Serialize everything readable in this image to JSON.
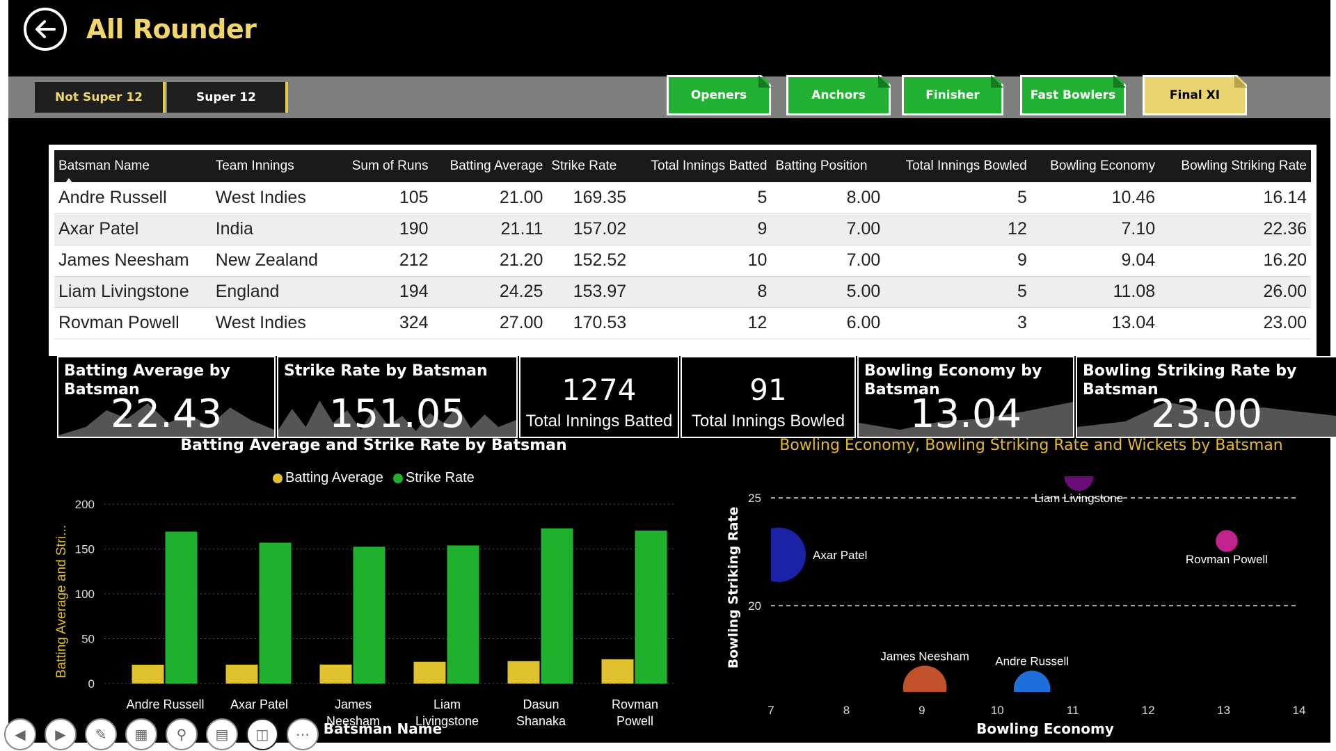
{
  "header": {
    "title": "All Rounder",
    "back_icon": "back-arrow-icon"
  },
  "slicers": [
    {
      "label": "Not Super 12",
      "selected": true
    },
    {
      "label": "Super 12",
      "selected": false
    }
  ],
  "nav_buttons": {
    "openers": "Openers",
    "anchors": "Anchors",
    "finisher": "Finisher",
    "fast_bowlers": "Fast Bowlers",
    "final_xi": "Final XI"
  },
  "colors": {
    "accent_yellow": "#e9d470",
    "green": "#22b133",
    "bar_yellow": "#e0c12e",
    "bar_green": "#1fb12d"
  },
  "table": {
    "columns": [
      "Batsman Name",
      "Team Innings",
      "Sum of Runs",
      "Batting Average",
      "Strike Rate",
      "Total Innings Batted",
      "Batting Position",
      "Total Innings Bowled",
      "Bowling Economy",
      "Bowling Striking Rate"
    ],
    "rows": [
      [
        "Andre Russell",
        "West Indies",
        "105",
        "21.00",
        "169.35",
        "5",
        "8.00",
        "5",
        "10.46",
        "16.14"
      ],
      [
        "Axar Patel",
        "India",
        "190",
        "21.11",
        "157.02",
        "9",
        "7.00",
        "12",
        "7.10",
        "22.36"
      ],
      [
        "James Neesham",
        "New Zealand",
        "212",
        "21.20",
        "152.52",
        "10",
        "7.00",
        "9",
        "9.04",
        "16.20"
      ],
      [
        "Liam Livingstone",
        "England",
        "194",
        "24.25",
        "153.97",
        "8",
        "5.00",
        "5",
        "11.08",
        "26.00"
      ],
      [
        "Rovman Powell",
        "West Indies",
        "324",
        "27.00",
        "170.53",
        "12",
        "6.00",
        "3",
        "13.04",
        "23.00"
      ]
    ]
  },
  "kpis": {
    "batting_avg": {
      "title": "Batting Average by Batsman",
      "value": "22.43"
    },
    "strike_rate": {
      "title": "Strike Rate by Batsman",
      "value": "151.05"
    },
    "innings_batted": {
      "value": "1274",
      "label": "Total Innings Batted"
    },
    "innings_bowled": {
      "value": "91",
      "label": "Total Innings Bowled"
    },
    "bowling_economy": {
      "title": "Bowling Economy by Batsman",
      "value": "13.04"
    },
    "bowling_sr": {
      "title": "Bowling Striking Rate by Batsman",
      "value": "23.00"
    }
  },
  "chart_data": [
    {
      "type": "bar",
      "title": "Batting Average and Strike Rate by Batsman",
      "xlabel": "Batsman Name",
      "ylabel": "Batting Average and Stri...",
      "ylim": [
        0,
        200
      ],
      "yticks": [
        0,
        50,
        100,
        150,
        200
      ],
      "categories": [
        "Andre Russell",
        "Axar Patel",
        "James Neesham",
        "Liam Livingstone",
        "Dasun Shanaka",
        "Rovman Powell"
      ],
      "category_lines": [
        [
          "Andre Russell"
        ],
        [
          "Axar Patel"
        ],
        [
          "James",
          "Neesham"
        ],
        [
          "Liam",
          "Livingstone"
        ],
        [
          "Dasun",
          "Shanaka"
        ],
        [
          "Rovman",
          "Powell"
        ]
      ],
      "series": [
        {
          "name": "Batting Average",
          "color": "#e0c12e",
          "values": [
            21.0,
            21.11,
            21.2,
            24.25,
            25.0,
            27.0
          ]
        },
        {
          "name": "Strike Rate",
          "color": "#1fb12d",
          "values": [
            169.35,
            157.02,
            152.52,
            153.97,
            173.0,
            170.53
          ]
        }
      ],
      "legend": "top-center",
      "grid": true
    },
    {
      "type": "scatter",
      "title": "Bowling Economy, Bowling Striking Rate and Wickets by Batsman",
      "xlabel": "Bowling Economy",
      "ylabel": "Bowling Striking Rate",
      "xticks": [
        7,
        8,
        9,
        10,
        11,
        12,
        13,
        14
      ],
      "yticks": [
        20,
        25
      ],
      "xlim": [
        7,
        14
      ],
      "ylim": [
        16,
        26
      ],
      "grid": true,
      "points": [
        {
          "label": "Axar Patel",
          "x": 7.1,
          "y": 22.36,
          "size": 12,
          "color": "#1a22a8"
        },
        {
          "label": "Liam Livingstone",
          "x": 11.08,
          "y": 26.0,
          "size": 5,
          "color": "#6a0d7a"
        },
        {
          "label": "Rovman Powell",
          "x": 13.04,
          "y": 23.0,
          "size": 3,
          "color": "#c1228e"
        },
        {
          "label": "James Neesham",
          "x": 9.04,
          "y": 16.2,
          "size": 9,
          "color": "#c2502a"
        },
        {
          "label": "Andre Russell",
          "x": 10.46,
          "y": 16.14,
          "size": 7,
          "color": "#1e6fd9"
        }
      ]
    }
  ],
  "toolbar": [
    "prev-icon",
    "next-icon",
    "pen-icon",
    "layout-icon",
    "zoom-icon",
    "caption-icon",
    "camera-icon",
    "more-icon"
  ]
}
